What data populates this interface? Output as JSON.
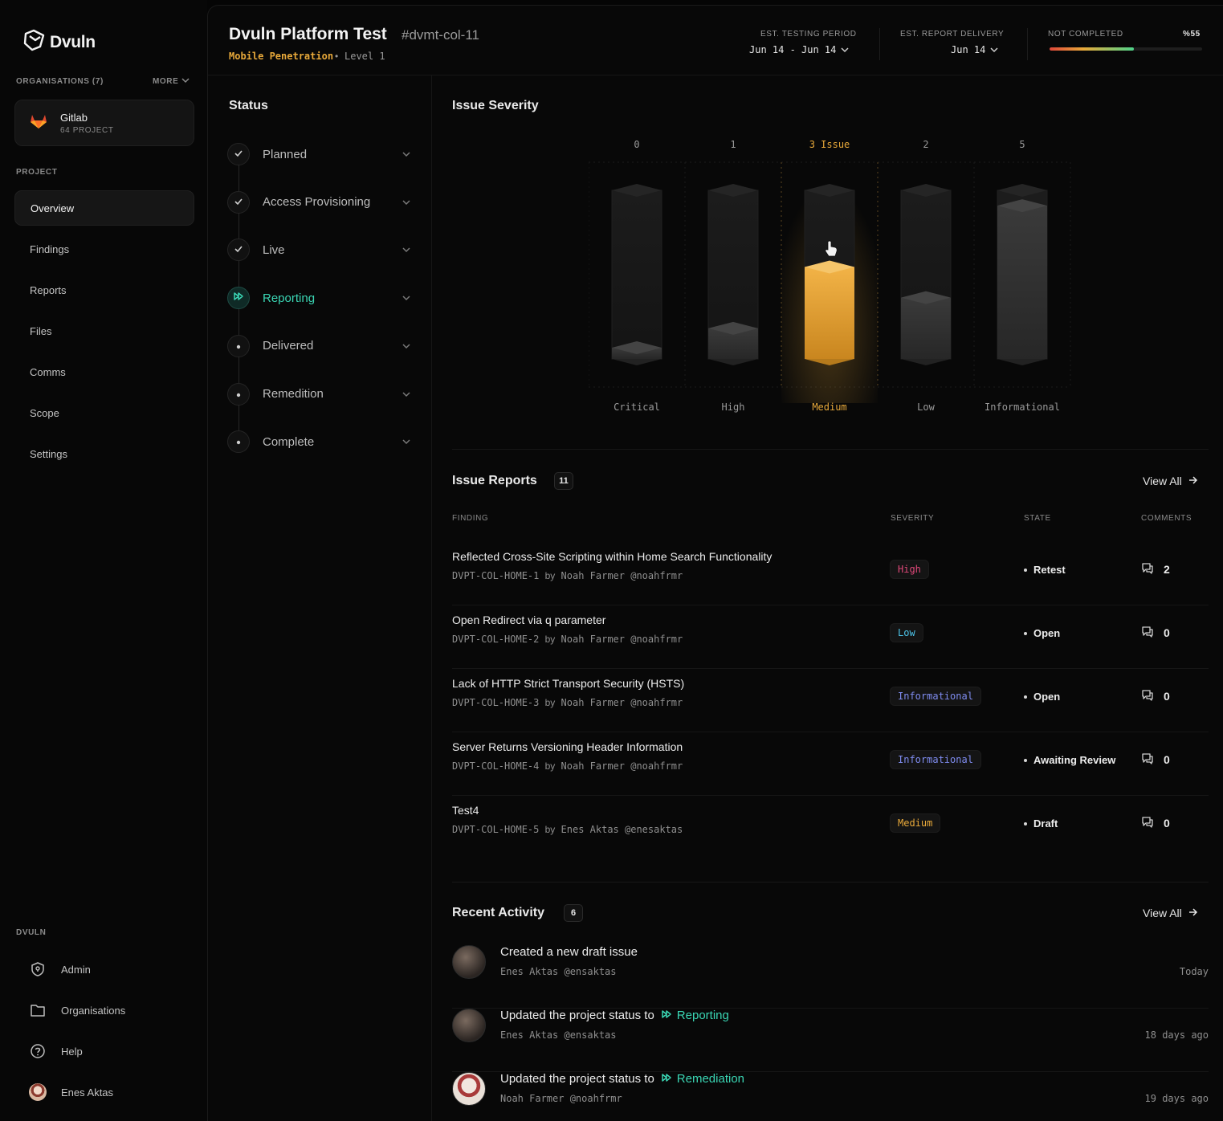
{
  "sidebar": {
    "logo_text": "Dvuln",
    "organisations_label": "ORGANISATIONS (7)",
    "more_label": "MORE",
    "org": {
      "name": "Gitlab",
      "sub": "64 PROJECT"
    },
    "project_label": "PROJECT",
    "nav": [
      "Overview",
      "Findings",
      "Reports",
      "Files",
      "Comms",
      "Scope",
      "Settings"
    ],
    "active_nav": "Overview",
    "footer_label": "DVULN",
    "footer": {
      "admin": "Admin",
      "organisations": "Organisations",
      "help": "Help",
      "user": "Enes Aktas"
    }
  },
  "header": {
    "title": "Dvuln Platform Test",
    "code": "#dvmt-col-11",
    "type": "Mobile Penetration",
    "dot": "•",
    "level": "Level 1",
    "testing_label": "EST. TESTING PERIOD",
    "testing_value": "Jun 14 - Jun 14",
    "delivery_label": "EST. REPORT DELIVERY",
    "delivery_value": "Jun 14",
    "progress_label": "NOT COMPLETED",
    "progress_value_text": "%55",
    "progress_percent": 55
  },
  "status": {
    "title": "Status",
    "steps": [
      {
        "label": "Planned",
        "state": "done"
      },
      {
        "label": "Access Provisioning",
        "state": "done"
      },
      {
        "label": "Live",
        "state": "done"
      },
      {
        "label": "Reporting",
        "state": "current"
      },
      {
        "label": "Delivered",
        "state": "pending"
      },
      {
        "label": "Remedition",
        "state": "pending"
      },
      {
        "label": "Complete",
        "state": "pending"
      }
    ]
  },
  "severity": {
    "title": "Issue Severity"
  },
  "chart_data": {
    "type": "bar",
    "categories": [
      "Critical",
      "High",
      "Medium",
      "Low",
      "Informational"
    ],
    "values": [
      0,
      1,
      3,
      2,
      5
    ],
    "top_labels": [
      "0",
      "1",
      "3 Issue",
      "2",
      "5"
    ],
    "highlighted": "Medium",
    "highlight_color": "#e8a93a",
    "ylim": [
      0,
      5.5
    ]
  },
  "reports": {
    "title": "Issue Reports",
    "count": "11",
    "view_all": "View All",
    "columns": {
      "finding": "FINDING",
      "severity": "SEVERITY",
      "state": "STATE",
      "comments": "COMMENTS"
    },
    "rows": [
      {
        "title": "Reflected Cross-Site Scripting within Home Search Functionality",
        "id": "DVPT-COL-HOME-1",
        "by": "by",
        "author": "Noah Farmer @noahfrmr",
        "severity": "High",
        "severity_color": "#e0487a",
        "state": "Retest",
        "comments": "2"
      },
      {
        "title": "Open Redirect via q parameter",
        "id": "DVPT-COL-HOME-2",
        "by": "by",
        "author": "Noah Farmer @noahfrmr",
        "severity": "Low",
        "severity_color": "#4cc3e8",
        "state": "Open",
        "comments": "0"
      },
      {
        "title": "Lack of HTTP Strict Transport Security (HSTS)",
        "id": "DVPT-COL-HOME-3",
        "by": "by",
        "author": "Noah Farmer @noahfrmr",
        "severity": "Informational",
        "severity_color": "#7f8cf0",
        "state": "Open",
        "comments": "0"
      },
      {
        "title": "Server Returns Versioning Header Information",
        "id": "DVPT-COL-HOME-4",
        "by": "by",
        "author": "Noah Farmer @noahfrmr",
        "severity": "Informational",
        "severity_color": "#7f8cf0",
        "state": "Awaiting Review",
        "comments": "0"
      },
      {
        "title": "Test4",
        "id": "DVPT-COL-HOME-5",
        "by": "by",
        "author": "Enes Aktas @enesaktas",
        "severity": "Medium",
        "severity_color": "#e8a93a",
        "state": "Draft",
        "comments": "0"
      }
    ]
  },
  "activity": {
    "title": "Recent Activity",
    "count": "6",
    "view_all": "View All",
    "items": [
      {
        "text": "Created a new draft issue",
        "status": "",
        "user": "Enes Aktas @ensaktas",
        "time": "Today",
        "avatar": "dark"
      },
      {
        "text": "Updated the project status to",
        "status": "Reporting",
        "user": "Enes Aktas @ensaktas",
        "time": "18 days ago",
        "avatar": "dark"
      },
      {
        "text": "Updated the project status to",
        "status": "Remediation",
        "user": "Noah Farmer @noahfrmr",
        "time": "19 days ago",
        "avatar": "light"
      }
    ]
  }
}
